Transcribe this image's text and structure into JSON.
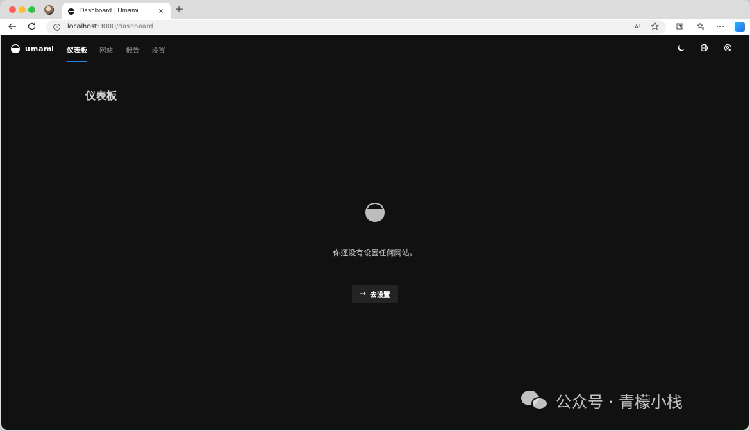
{
  "browser": {
    "tab_title": "Dashboard | Umami",
    "tab_close": "×",
    "new_tab": "+",
    "url_host": "localhost",
    "url_rest": ":3000/dashboard",
    "read_aloud": "A⁾"
  },
  "app": {
    "brand": "umami",
    "nav": [
      {
        "label": "仪表板",
        "active": true
      },
      {
        "label": "网站",
        "active": false
      },
      {
        "label": "报告",
        "active": false
      },
      {
        "label": "设置",
        "active": false
      }
    ],
    "accent_color": "#2680eb"
  },
  "main": {
    "title": "仪表板",
    "empty_message": "你还没有设置任何网站。",
    "button_label": "去设置"
  },
  "watermark": {
    "text": "公众号 · 青檬小栈"
  }
}
